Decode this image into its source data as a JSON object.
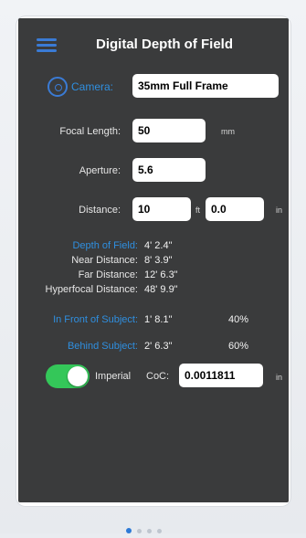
{
  "header": {
    "title": "Digital Depth of Field"
  },
  "camera": {
    "label": "Camera:",
    "value": "35mm Full Frame"
  },
  "focal_length": {
    "label": "Focal Length:",
    "value": "50",
    "unit": "mm"
  },
  "aperture": {
    "label": "Aperture:",
    "value": "5.6"
  },
  "distance": {
    "label": "Distance:",
    "feet_value": "10",
    "feet_unit": "ft",
    "inches_value": "0.0",
    "inches_unit": "in"
  },
  "results": {
    "depth_of_field": {
      "label": "Depth of Field:",
      "value": "4' 2.4\""
    },
    "near_distance": {
      "label": "Near Distance:",
      "value": "8' 3.9\""
    },
    "far_distance": {
      "label": "Far Distance:",
      "value": "12' 6.3\""
    },
    "hyperfocal": {
      "label": "Hyperfocal Distance:",
      "value": "48' 9.9\""
    },
    "in_front": {
      "label": "In Front of Subject:",
      "value": "1' 8.1\"",
      "percent": "40%"
    },
    "behind": {
      "label": "Behind Subject:",
      "value": "2' 6.3\"",
      "percent": "60%"
    }
  },
  "units": {
    "toggle_label": "Imperial",
    "enabled": true
  },
  "coc": {
    "label": "CoC:",
    "value": "0.0011811",
    "unit": "in"
  },
  "pager": {
    "total": 4,
    "active": 1
  },
  "colors": {
    "accent": "#2f8fe0",
    "toggle_on": "#34c759",
    "panel": "#3a3b3c"
  }
}
